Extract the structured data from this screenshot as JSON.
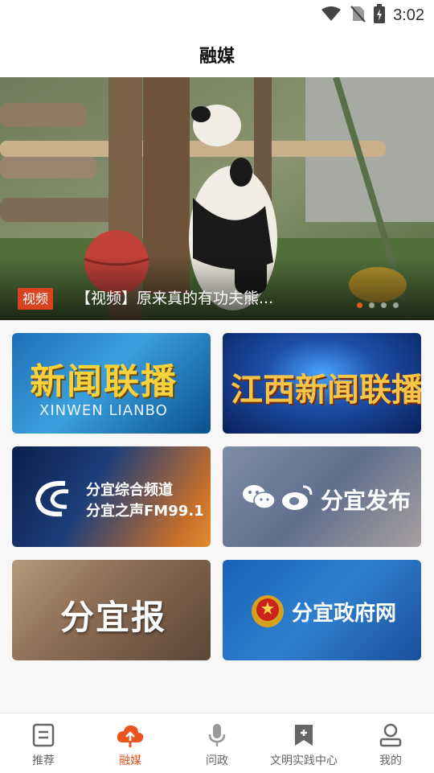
{
  "status_bar": {
    "time": "3:02",
    "icons": [
      "wifi-icon",
      "no-sim-icon",
      "battery-charging-icon"
    ]
  },
  "header": {
    "title": "融媒"
  },
  "banner": {
    "tag": "视频",
    "caption": "【视频】原来真的有功夫熊...",
    "slide_count": 4,
    "active_slide": 1
  },
  "cards": [
    {
      "title": "新闻联播",
      "subtitle": "XINWEN LIANBO"
    },
    {
      "title": "江西新闻联播"
    },
    {
      "line1": "分宜综合频道",
      "line2": "分宜之声FM99.1"
    },
    {
      "title": "分宜发布",
      "icons": [
        "wechat-icon",
        "weibo-icon"
      ]
    },
    {
      "title": "分宜报"
    },
    {
      "title": "分宜政府网",
      "icons": [
        "national-emblem-icon"
      ]
    }
  ],
  "tab_bar": {
    "active": 1,
    "tabs": [
      {
        "label": "推荐",
        "icon": "document-icon"
      },
      {
        "label": "融媒",
        "icon": "cloud-upload-icon"
      },
      {
        "label": "问政",
        "icon": "microphone-icon"
      },
      {
        "label": "文明实践中心",
        "icon": "bookmark-add-icon"
      },
      {
        "label": "我的",
        "icon": "user-icon"
      }
    ]
  },
  "colors": {
    "accent": "#e8561d",
    "tag_bg": "#d8421e"
  }
}
